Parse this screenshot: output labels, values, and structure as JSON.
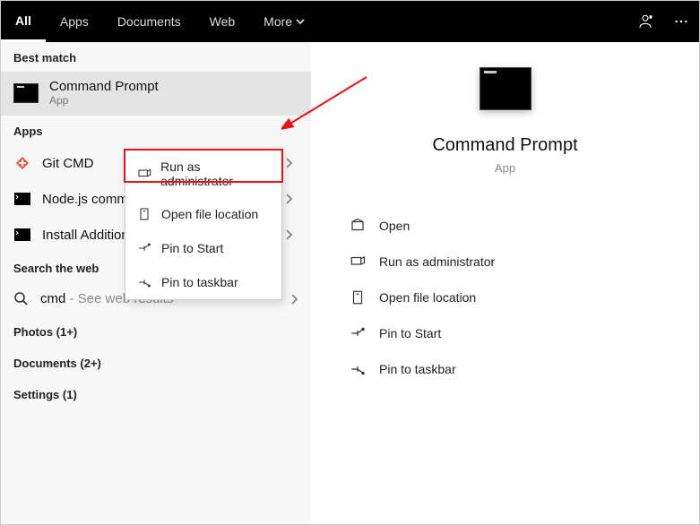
{
  "topbar": {
    "tabs": {
      "all": "All",
      "apps": "Apps",
      "documents": "Documents",
      "web": "Web",
      "more": "More"
    }
  },
  "left": {
    "best_match_label": "Best match",
    "best": {
      "title": "Command Prompt",
      "sub": "App"
    },
    "apps_label": "Apps",
    "apps": {
      "git": "Git CMD",
      "node": "Node.js comm",
      "install": "Install Additional Tools for Node.js"
    },
    "search_web_label": "Search the web",
    "search": {
      "term": "cmd",
      "hint": " - See web results"
    },
    "photos": "Photos (1+)",
    "documents": "Documents (2+)",
    "settings": "Settings (1)"
  },
  "ctx": {
    "run_admin": "Run as administrator",
    "open_loc": "Open file location",
    "pin_start": "Pin to Start",
    "pin_taskbar": "Pin to taskbar"
  },
  "right": {
    "title": "Command Prompt",
    "sub": "App",
    "actions": {
      "open": "Open",
      "run_admin": "Run as administrator",
      "open_loc": "Open file location",
      "pin_start": "Pin to Start",
      "pin_taskbar": "Pin to taskbar"
    }
  }
}
